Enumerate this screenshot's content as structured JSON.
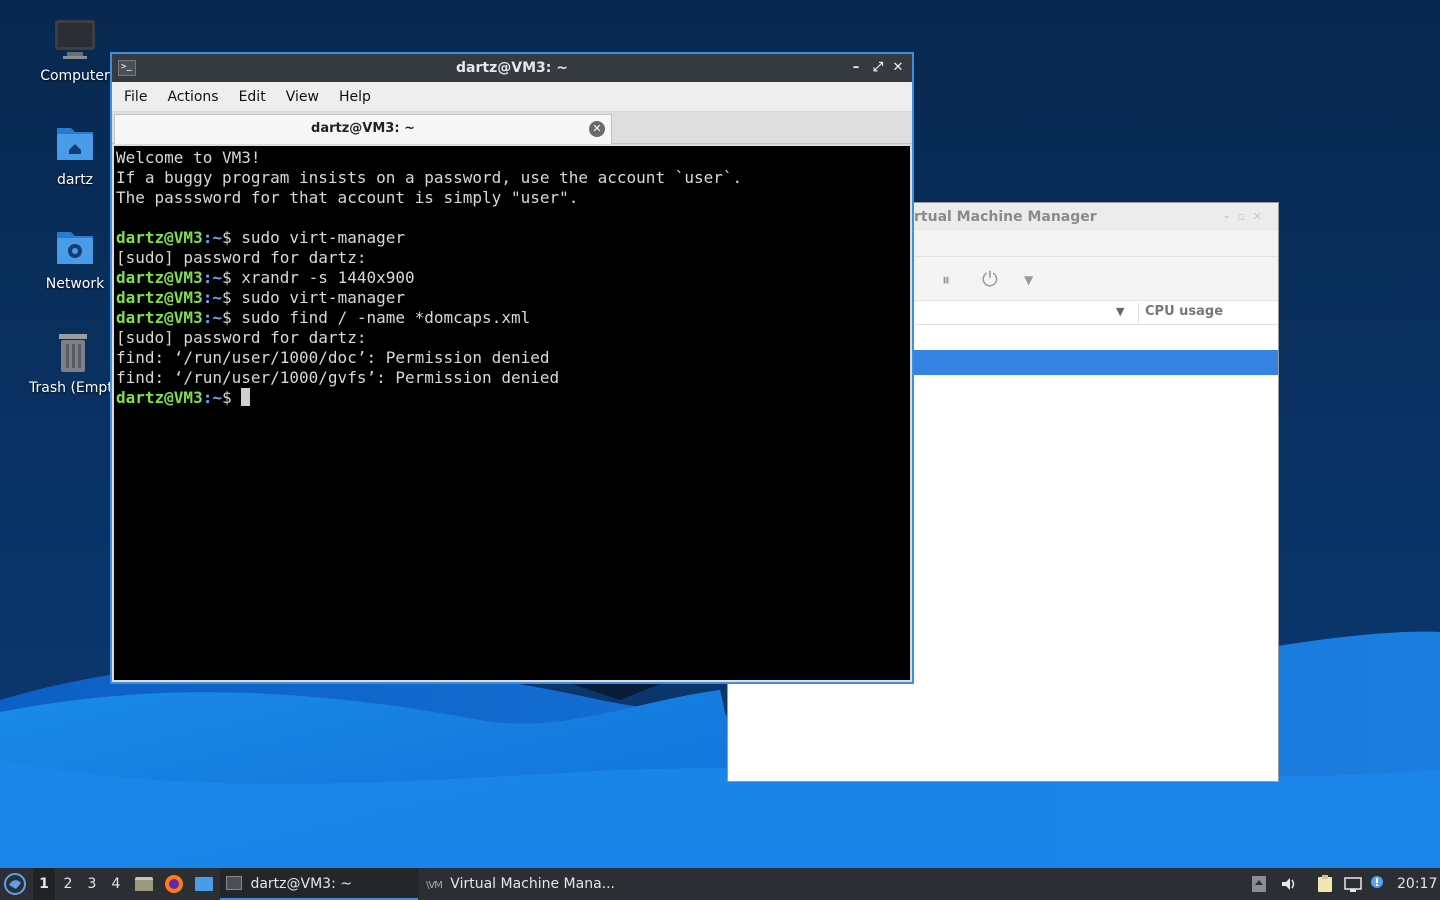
{
  "desktop": {
    "icons": [
      {
        "label": "Computer"
      },
      {
        "label": "dartz"
      },
      {
        "label": "Network"
      },
      {
        "label": "Trash (Empty)"
      }
    ]
  },
  "vmm_window": {
    "title": "Virtual Machine Manager",
    "visible_title": "rtual Machine Manager",
    "columns": {
      "cpu": "CPU usage"
    }
  },
  "terminal": {
    "title": "dartz@VM3: ~",
    "menu": [
      "File",
      "Actions",
      "Edit",
      "View",
      "Help"
    ],
    "tab_label": "dartz@VM3: ~",
    "prompt_user": "dartz@VM3",
    "prompt_path": ":~",
    "lines": [
      {
        "type": "out",
        "text": "Welcome to VM3!"
      },
      {
        "type": "out",
        "text": "If a buggy program insists on a password, use the account `user`."
      },
      {
        "type": "out",
        "text": "The passsword for that account is simply \"user\"."
      },
      {
        "type": "out",
        "text": ""
      },
      {
        "type": "cmd",
        "text": "sudo virt-manager"
      },
      {
        "type": "out",
        "text": "[sudo] password for dartz:"
      },
      {
        "type": "cmd",
        "text": "xrandr -s 1440x900"
      },
      {
        "type": "cmd",
        "text": "sudo virt-manager"
      },
      {
        "type": "cmd",
        "text": "sudo find / -name *domcaps.xml"
      },
      {
        "type": "out",
        "text": "[sudo] password for dartz:"
      },
      {
        "type": "out",
        "text": "find: ‘/run/user/1000/doc’: Permission denied"
      },
      {
        "type": "out",
        "text": "find: ‘/run/user/1000/gvfs’: Permission denied"
      },
      {
        "type": "prompt",
        "text": ""
      }
    ]
  },
  "taskbar": {
    "workspaces": [
      "1",
      "2",
      "3",
      "4"
    ],
    "active_workspace": "1",
    "tasks": [
      {
        "label": "dartz@VM3: ~",
        "active": true
      },
      {
        "label": "Virtual Machine Mana...",
        "active": false
      }
    ],
    "clock": "20:17"
  },
  "colors": {
    "accent": "#3d8fe0",
    "prompt_user": "#7fe04a",
    "prompt_path": "#6fa8ff",
    "selection": "#3584e4"
  }
}
